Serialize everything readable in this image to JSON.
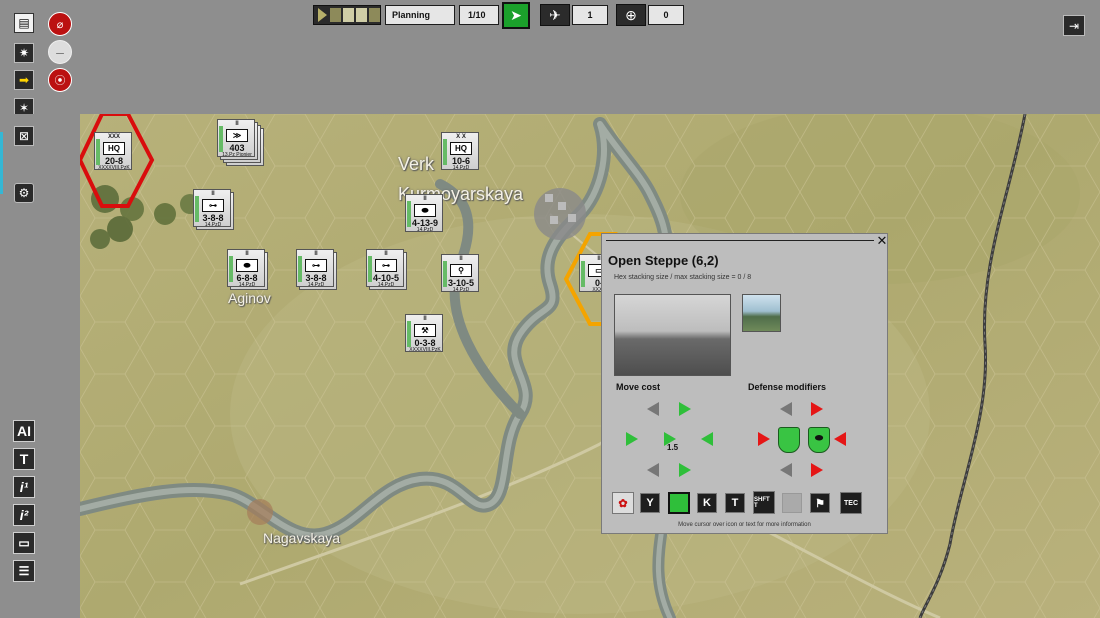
{
  "top_bar": {
    "phase_label": "Planning",
    "turn_label": "1/10",
    "air_value": "1",
    "naval_value": "0"
  },
  "left_toolbar": {
    "bottom_labels": [
      "AI",
      "T",
      "i¹",
      "i²"
    ]
  },
  "map": {
    "places": [
      "Verk",
      "Kurmoyarskaya",
      "Aginov",
      "Nagavskaya"
    ]
  },
  "units": [
    {
      "size": "XXX",
      "symbol": "HQ",
      "values": "20-8",
      "name": "XXXXVIII.PzK"
    },
    {
      "size": "II",
      "symbol": "≫",
      "values": "403",
      "name": "13.Pz Pionier"
    },
    {
      "size": "X X",
      "symbol": "HQ",
      "values": "10-6",
      "name": "14.PzD"
    },
    {
      "size": "II",
      "symbol": "⊶",
      "values": "3-8-8",
      "name": "14.PzD"
    },
    {
      "size": "II",
      "symbol": "⬬",
      "values": "4-13-9",
      "name": "14.PzD"
    },
    {
      "size": "II",
      "symbol": "⬬",
      "values": "6-8-8",
      "name": "14.PzD"
    },
    {
      "size": "II",
      "symbol": "⊶",
      "values": "3-8-8",
      "name": "14.PzD"
    },
    {
      "size": "II",
      "symbol": "⊶",
      "values": "4-10-5",
      "name": "14.PzD"
    },
    {
      "size": "II",
      "symbol": "⚲",
      "values": "3-10-5",
      "name": "14.PzD"
    },
    {
      "size": "II",
      "symbol": "⚒",
      "values": "0-3-8",
      "name": "XXXXVIII.PzK"
    },
    {
      "size": "II",
      "symbol": "▭",
      "values": "0-",
      "name": "XXXX"
    }
  ],
  "hex_info": {
    "title": "Open Steppe (6,2)",
    "stacking": "Hex stacking size / max stacking size = 0 / 8",
    "move_cost_label": "Move cost",
    "defense_label": "Defense modifiers",
    "center_cost": "1.5",
    "bottom_icons": [
      "Y",
      "K",
      "T",
      "SHFT T",
      "TEC"
    ],
    "hint": "Move cursor over icon or text for more information"
  },
  "colors": {
    "map_base": "#b5ae74",
    "panel_bg": "#bdbdbd",
    "arrow_green": "#2fbf3a",
    "arrow_red": "#e51616",
    "select_red": "#d90d0d",
    "select_orange": "#f4a400"
  }
}
